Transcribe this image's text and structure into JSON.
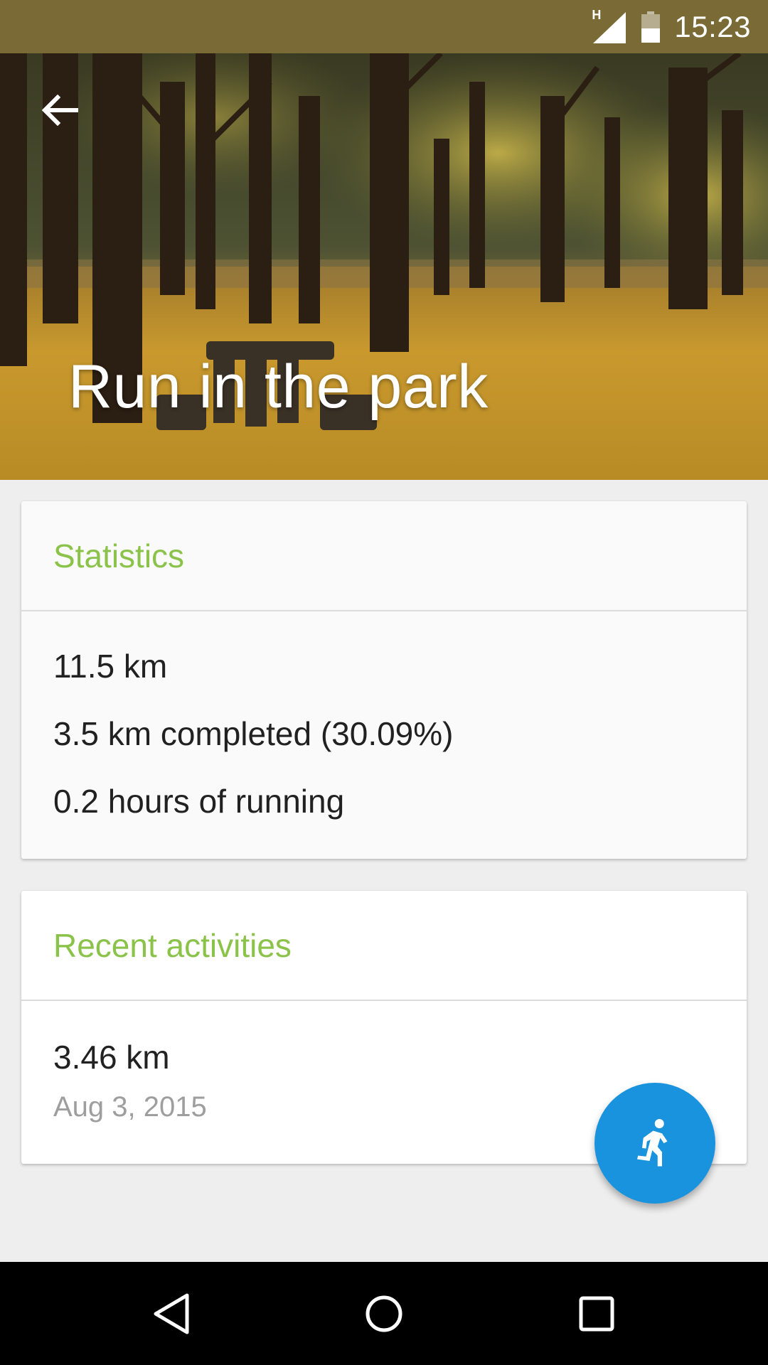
{
  "status_bar": {
    "time": "15:23",
    "network_type": "H",
    "battery_level": 0.5
  },
  "header": {
    "title": "Run in the park",
    "back_icon": "arrow-back-icon"
  },
  "statistics": {
    "title": "Statistics",
    "lines": [
      "11.5 km",
      "3.5 km completed (30.09%)",
      "0.2 hours of running"
    ]
  },
  "recent_activities": {
    "title": "Recent activities",
    "items": [
      {
        "distance": "3.46 km",
        "date": "Aug 3, 2015"
      }
    ]
  },
  "fab": {
    "icon": "running-person-icon"
  },
  "navigation": {
    "back_icon": "nav-back-icon",
    "home_icon": "nav-home-icon",
    "recents_icon": "nav-recents-icon"
  },
  "colors": {
    "status_bar": "#7a6a36",
    "accent_green": "#8bc34a",
    "fab_blue": "#1a93df"
  }
}
